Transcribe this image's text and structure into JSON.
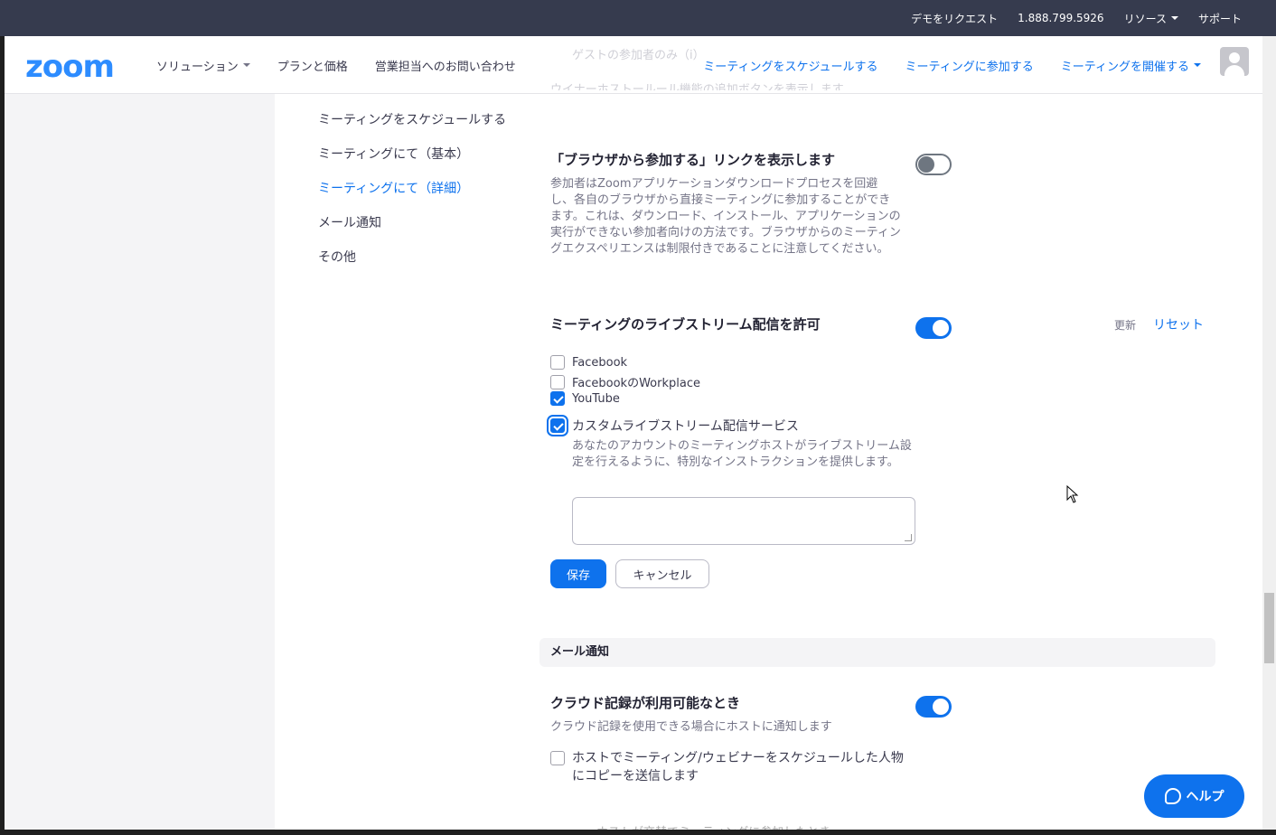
{
  "topbar": {
    "demo": "デモをリクエスト",
    "phone": "1.888.799.5926",
    "resources": "リソース",
    "support": "サポート"
  },
  "header": {
    "logo": "zoom",
    "solutions": "ソリューション",
    "plans": "プランと価格",
    "sales": "営業担当へのお問い合わせ",
    "schedule": "ミーティングをスケジュールする",
    "join": "ミーティングに参加する",
    "host": "ミーティングを開催する"
  },
  "ghost": {
    "line1": "ゲストの参加者のみ（i）",
    "line2": "ウイナーホストールール機能の追加ボタンを表示します"
  },
  "sidemenu": {
    "items": [
      {
        "label": "ミーティングをスケジュールする"
      },
      {
        "label": "ミーティングにて（基本）"
      },
      {
        "label": "ミーティングにて（詳細）"
      },
      {
        "label": "メール通知"
      },
      {
        "label": "その他"
      }
    ]
  },
  "browser_join": {
    "title": "「ブラウザから参加する」リンクを表示します",
    "desc": "参加者はZoomアプリケーションダウンロードプロセスを回避し、各自のブラウザから直接ミーティングに参加することができます。これは、ダウンロード、インストール、アプリケーションの実行ができない参加者向けの方法です。ブラウザからのミーティングエクスペリエンスは制限付きであることに注意してください。",
    "enabled": false
  },
  "livestream": {
    "title": "ミーティングのライブストリーム配信を許可",
    "enabled": true,
    "update": "更新",
    "reset": "リセット",
    "options": [
      {
        "label": "Facebook",
        "checked": false
      },
      {
        "label": "FacebookのWorkplace",
        "checked": false
      },
      {
        "label": "YouTube",
        "checked": true
      },
      {
        "label": "カスタムライブストリーム配信サービス",
        "checked": true
      }
    ],
    "custom_desc": "あなたのアカウントのミーティングホストがライブストリーム設定を行えるように、特別なインストラクションを提供します。",
    "textarea_value": "",
    "save": "保存",
    "cancel": "キャンセル"
  },
  "email_section": {
    "header": "メール通知",
    "cloud_title": "クラウド記録が利用可能なとき",
    "cloud_desc": "クラウド記録を使用できる場合にホストに通知します",
    "cloud_enabled": true,
    "copy_label_1": "ホストでミーティング/ウェビナーをスケジュールした人物",
    "copy_label_2": "にコピーを送信します",
    "copy_checked": false
  },
  "help": {
    "label": "ヘルプ"
  },
  "bottom_ghost": "ホストが交替でミーティングに参加したとき"
}
